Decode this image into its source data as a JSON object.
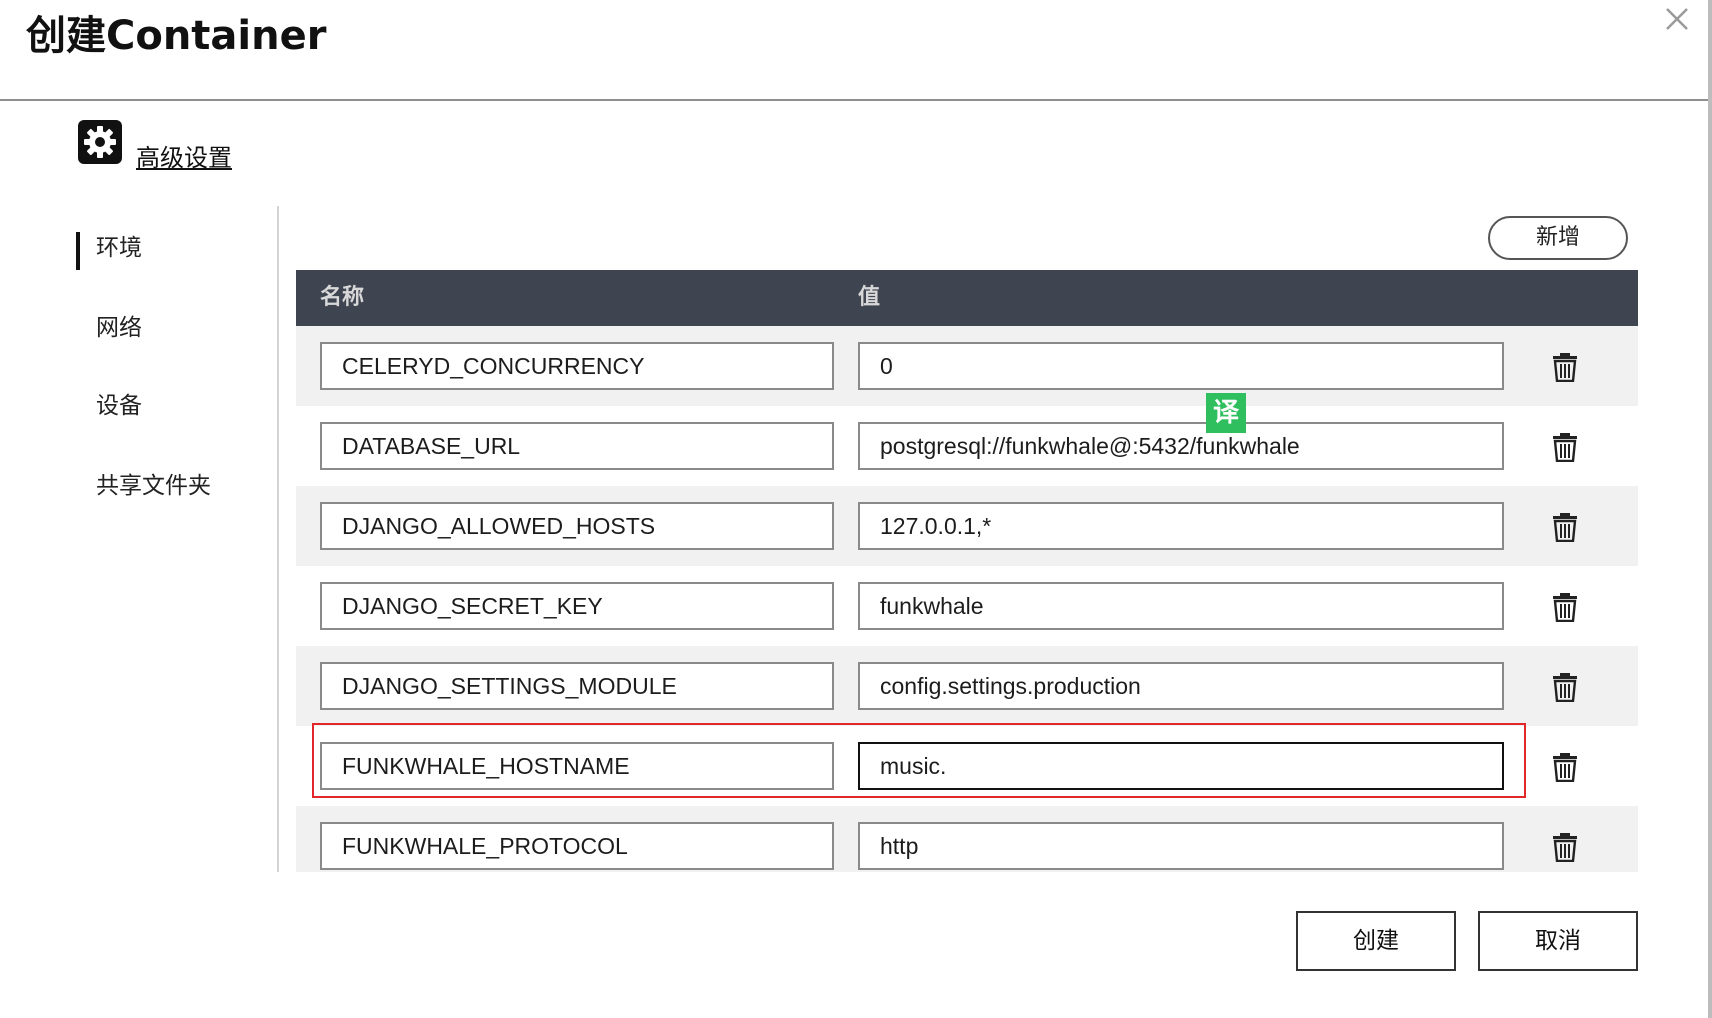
{
  "dialog": {
    "title": "创建Container"
  },
  "advanced": {
    "label": "高级设置"
  },
  "nav": {
    "items": [
      {
        "label": "环境",
        "active": true
      },
      {
        "label": "网络",
        "active": false
      },
      {
        "label": "设备",
        "active": false
      },
      {
        "label": "共享文件夹",
        "active": false
      }
    ]
  },
  "toolbar": {
    "add_label": "新增"
  },
  "table": {
    "headers": {
      "name": "名称",
      "value": "值"
    },
    "rows": [
      {
        "name": "CELERYD_CONCURRENCY",
        "value": "0"
      },
      {
        "name": "DATABASE_URL",
        "value": "postgresql://funkwhale@:5432/funkwhale"
      },
      {
        "name": "DJANGO_ALLOWED_HOSTS",
        "value": "127.0.0.1,*"
      },
      {
        "name": "DJANGO_SECRET_KEY",
        "value": "funkwhale"
      },
      {
        "name": "DJANGO_SETTINGS_MODULE",
        "value": "config.settings.production"
      },
      {
        "name": "FUNKWHALE_HOSTNAME",
        "value": "music.",
        "focused": true,
        "highlighted": true
      },
      {
        "name": "FUNKWHALE_PROTOCOL",
        "value": "http"
      }
    ]
  },
  "translate_badge": "译",
  "footer": {
    "create_label": "创建",
    "cancel_label": "取消"
  },
  "colors": {
    "header_bg": "#3f4451",
    "highlight_border": "#e3262a",
    "translate_badge": "#2fbf5f"
  },
  "icons": {
    "close": "close-icon",
    "gear": "gear-icon",
    "trash": "trash-icon"
  }
}
